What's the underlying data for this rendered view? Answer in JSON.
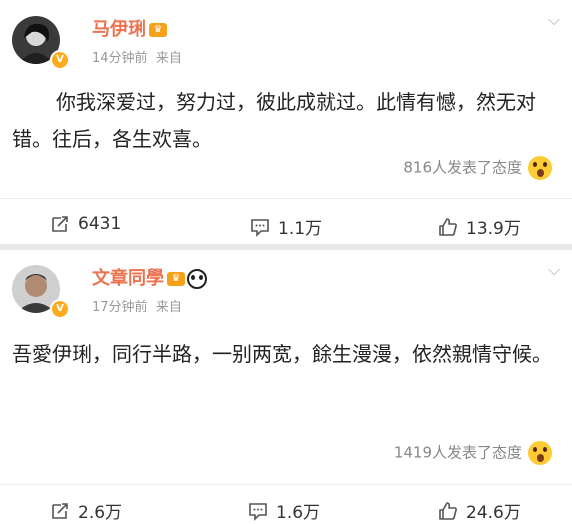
{
  "posts": [
    {
      "username": "马伊琍",
      "time": "14分钟前",
      "source": "来自",
      "content": "你我深爱过，努力过，彼此成就过。此情有憾，然无对错。往后，各生欢喜。",
      "attitude_text": "816人发表了态度",
      "repost_count": "6431",
      "comment_count": "1.1万",
      "like_count": "13.9万"
    },
    {
      "username": "文章同學",
      "time": "17分钟前",
      "source": "来自",
      "content": "吾愛伊琍，同行半路，一别两宽，餘生漫漫，依然親情守候。",
      "attitude_text": "1419人发表了态度",
      "repost_count": "2.6万",
      "comment_count": "1.6万",
      "like_count": "24.6万"
    }
  ],
  "icons": {
    "verified": "verified-badge-icon",
    "crown": "member-crown-icon",
    "panda": "panda-emoji-icon",
    "more": "chevron-down-icon",
    "surprised": "surprised-emoji-icon",
    "repost": "repost-icon",
    "comment": "comment-icon",
    "like": "thumbs-up-icon"
  },
  "colors": {
    "username": "#eb7350",
    "verified": "#ffab1f",
    "meta": "#999999"
  }
}
